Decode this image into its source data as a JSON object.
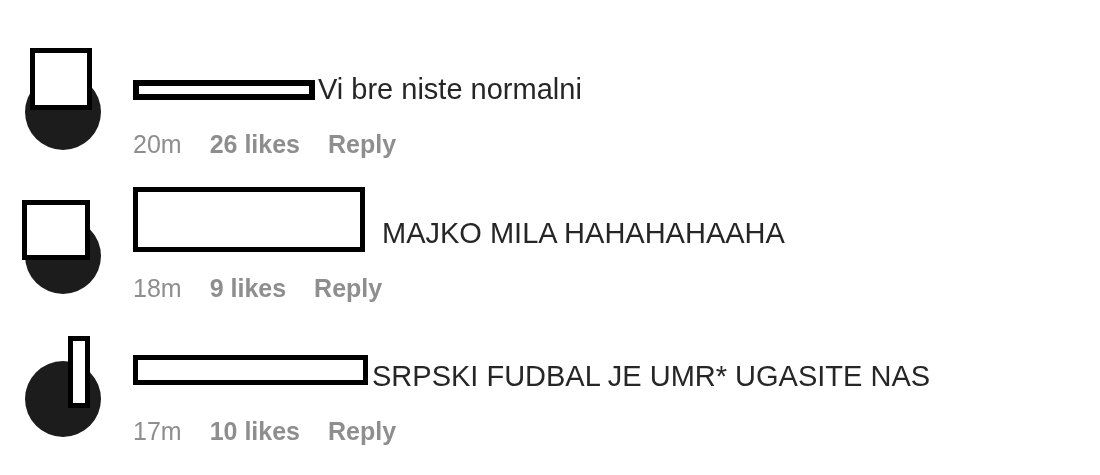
{
  "comments": [
    {
      "text": "Vi bre niste normalni",
      "time": "20m",
      "likes": "26 likes",
      "reply": "Reply",
      "kind": "bar"
    },
    {
      "text": "MAJKO MILA HAHAHAHAAHA",
      "time": "18m",
      "likes": "9 likes",
      "reply": "Reply",
      "kind": "box"
    },
    {
      "text": "SRPSKI FUDBAL JE UMR* UGASITE NAS",
      "time": "17m",
      "likes": "10 likes",
      "reply": "Reply",
      "kind": "narrow"
    }
  ]
}
